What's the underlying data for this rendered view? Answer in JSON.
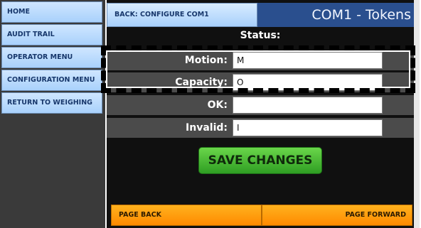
{
  "sidebar": {
    "items": [
      {
        "label": "HOME"
      },
      {
        "label": "AUDIT TRAIL"
      },
      {
        "label": "OPERATOR MENU"
      },
      {
        "label": "CONFIGURATION MENU"
      },
      {
        "label": "RETURN TO WEIGHING"
      }
    ]
  },
  "header": {
    "back_label": "BACK: CONFIGURE COM1",
    "title": "COM1 - Tokens"
  },
  "status": {
    "label": "Status:"
  },
  "fields": [
    {
      "label": "Motion:",
      "value": "M"
    },
    {
      "label": "Capacity:",
      "value": "O"
    },
    {
      "label": "OK:",
      "value": ""
    },
    {
      "label": "Invalid:",
      "value": "I"
    }
  ],
  "actions": {
    "save_label": "SAVE CHANGES",
    "page_back_label": "PAGE BACK",
    "page_forward_label": "PAGE FORWARD"
  },
  "colors": {
    "sidebar_button": "#a9d1fb",
    "title_bar": "#2a4f8e",
    "save_button": "#3cb52c",
    "nav_button": "#ff9a00"
  }
}
